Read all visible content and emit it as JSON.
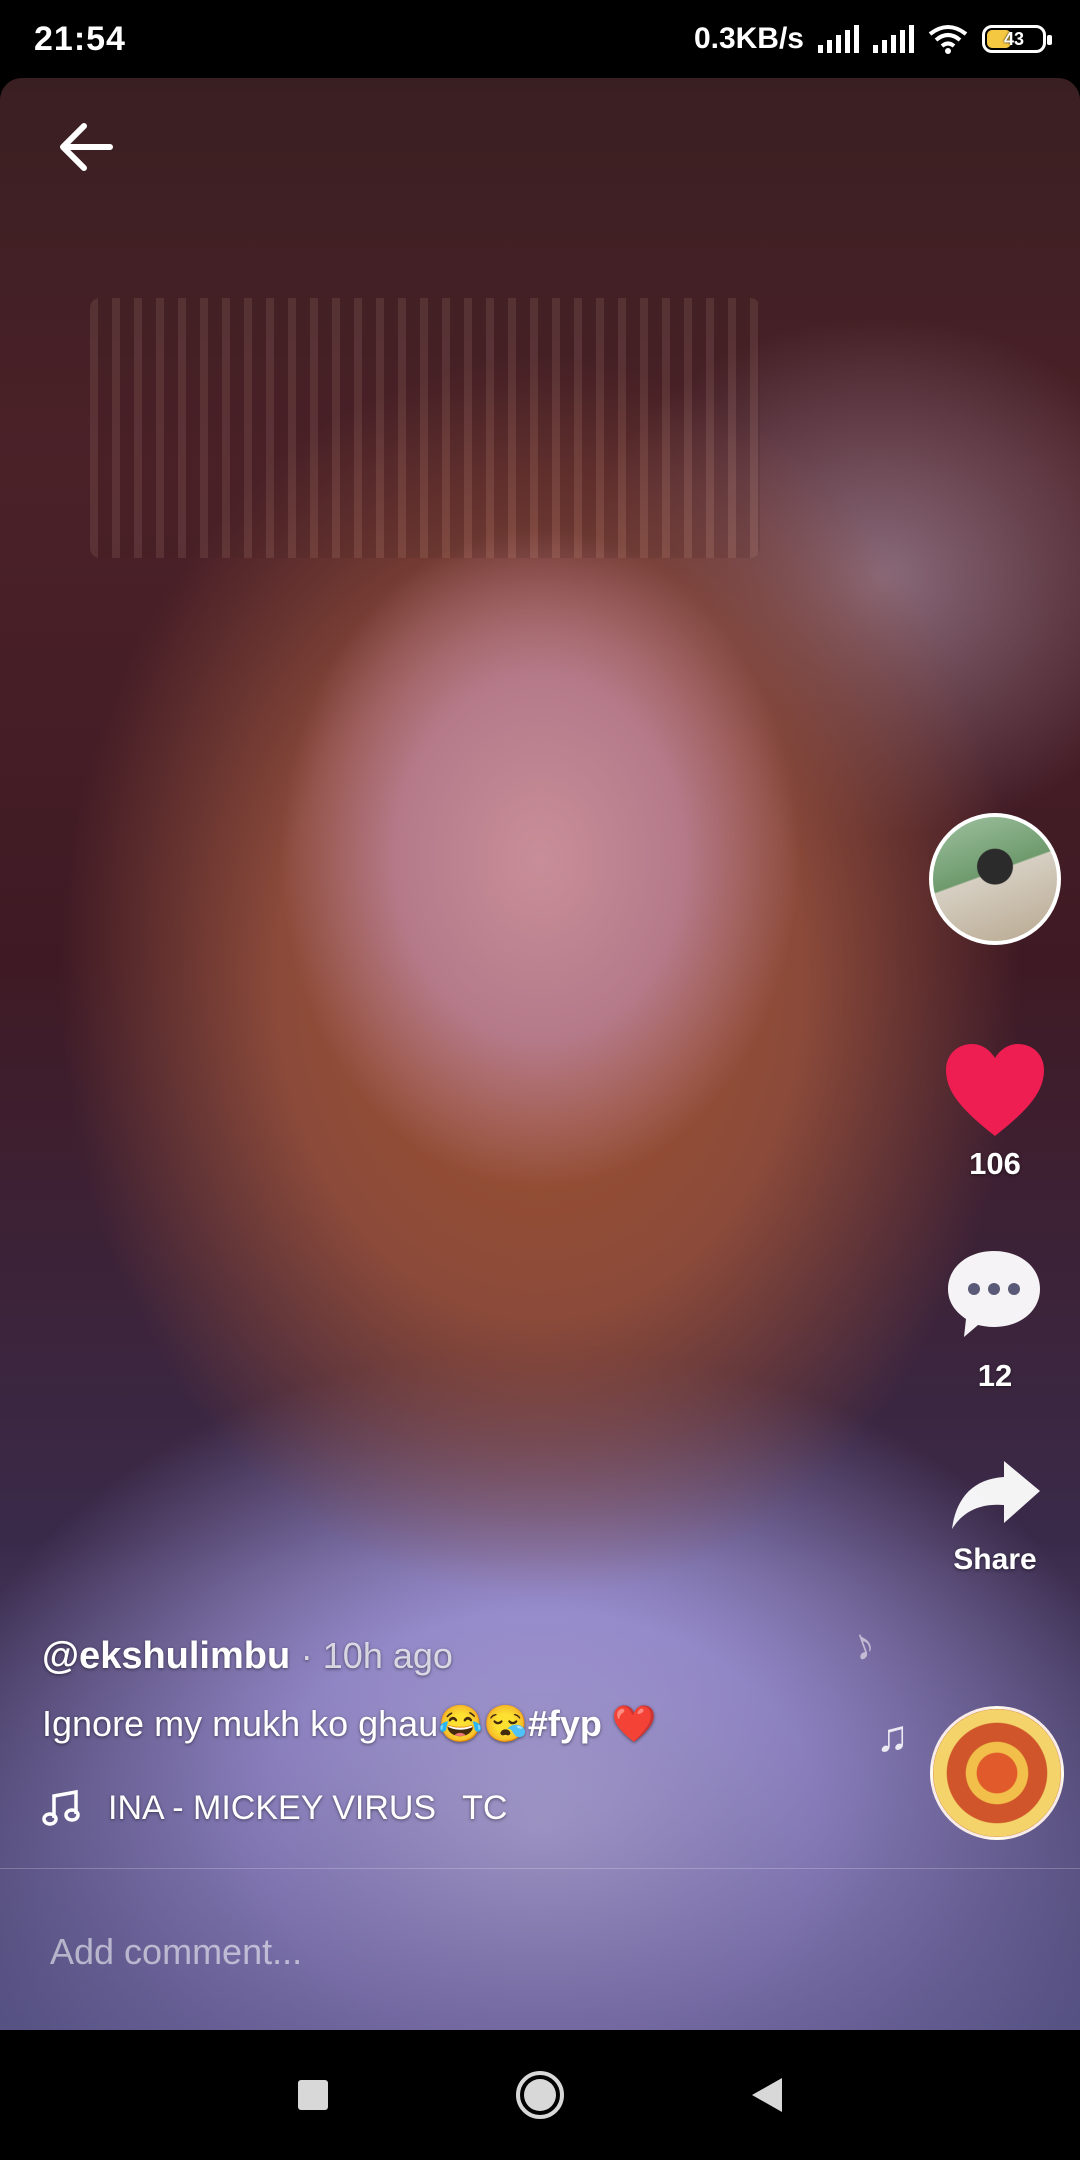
{
  "status_bar": {
    "time": "21:54",
    "network_speed": "0.3KB/s",
    "battery": "43",
    "icons": [
      "signal-icon",
      "signal-icon",
      "wifi-icon",
      "battery-icon"
    ]
  },
  "video": {
    "username": "@ekshulimbu",
    "time_ago": "10h ago",
    "caption_text": "Ignore my mukh ko ghau😂😪",
    "caption_hashtag": "#fyp",
    "caption_emoji_end": "❤️",
    "music_title": "INA - MICKEY VIRUS",
    "music_credit": "TC",
    "likes": "106",
    "comments": "12",
    "share_label": "Share"
  },
  "comment_bar": {
    "placeholder": "Add comment..."
  },
  "colors": {
    "like_red": "#ee1d52",
    "nav_background": "#000000"
  }
}
